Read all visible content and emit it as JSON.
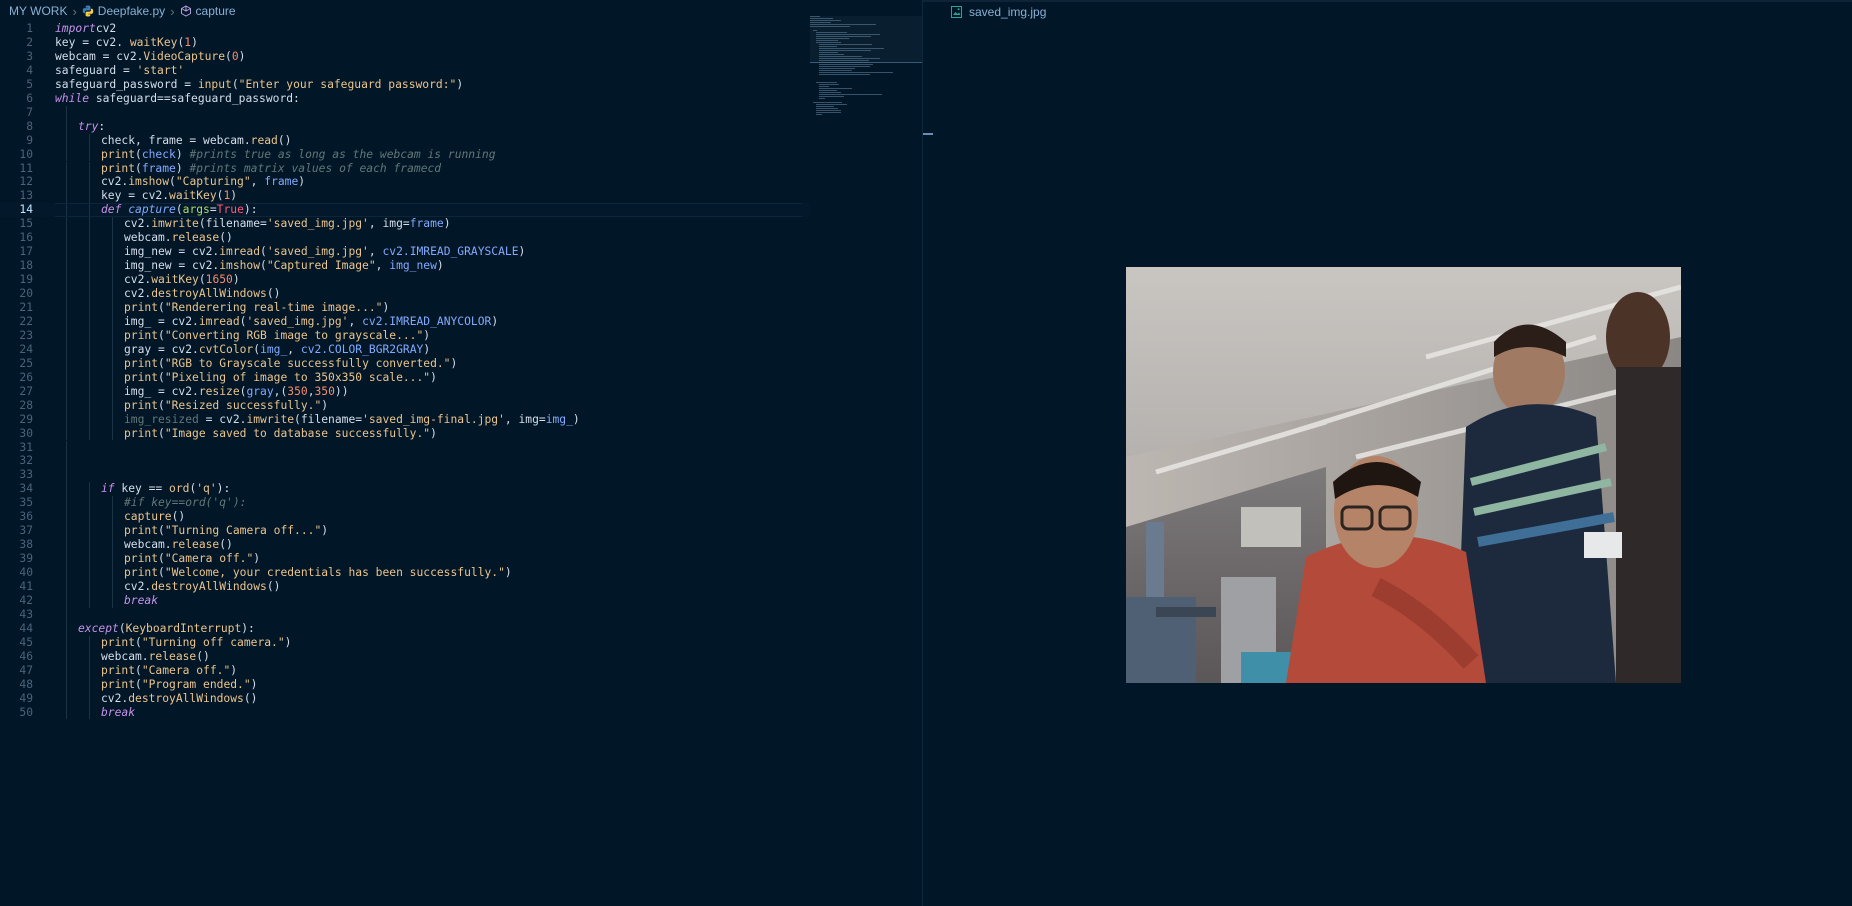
{
  "breadcrumb": {
    "root": "MY WORK",
    "file": "Deepfake.py",
    "symbol": "capture"
  },
  "preview": {
    "tab_label": "saved_img.jpg"
  },
  "editor": {
    "active_line": 14,
    "lines": [
      {
        "n": "1",
        "indent": 0,
        "tokens": [
          [
            "kw",
            "import"
          ],
          [
            "",
            "cv2"
          ]
        ]
      },
      {
        "n": "2",
        "indent": 0,
        "tokens": [
          [
            "",
            "key = cv2. "
          ],
          [
            "fn",
            "waitKey"
          ],
          [
            "",
            "("
          ],
          [
            "num",
            "1"
          ],
          [
            "",
            ")"
          ]
        ]
      },
      {
        "n": "3",
        "indent": 0,
        "tokens": [
          [
            "",
            "webcam = cv2."
          ],
          [
            "fn",
            "VideoCapture"
          ],
          [
            "",
            "("
          ],
          [
            "num",
            "0"
          ],
          [
            "",
            ")"
          ]
        ]
      },
      {
        "n": "4",
        "indent": 0,
        "tokens": [
          [
            "",
            "safeguard = "
          ],
          [
            "str",
            "'start'"
          ]
        ]
      },
      {
        "n": "5",
        "indent": 0,
        "tokens": [
          [
            "",
            "safeguard_password = "
          ],
          [
            "fn",
            "input"
          ],
          [
            "",
            "("
          ],
          [
            "str",
            "\"Enter your safeguard password:\""
          ],
          [
            "",
            ")"
          ]
        ]
      },
      {
        "n": "6",
        "indent": 0,
        "tokens": [
          [
            "kw",
            "while"
          ],
          [
            "",
            " safeguard==safeguard_password:"
          ]
        ]
      },
      {
        "n": "7",
        "indent": 1,
        "tokens": []
      },
      {
        "n": "8",
        "indent": 1,
        "tokens": [
          [
            "kw",
            "try"
          ],
          [
            "",
            ":"
          ]
        ]
      },
      {
        "n": "9",
        "indent": 2,
        "tokens": [
          [
            "",
            "check, frame = webcam."
          ],
          [
            "fn",
            "read"
          ],
          [
            "",
            "()"
          ]
        ]
      },
      {
        "n": "10",
        "indent": 2,
        "tokens": [
          [
            "fn",
            "print"
          ],
          [
            "",
            "("
          ],
          [
            "cst",
            "check"
          ],
          [
            "",
            ") "
          ],
          [
            "cm",
            "#prints true as long as the webcam is running"
          ]
        ]
      },
      {
        "n": "11",
        "indent": 2,
        "tokens": [
          [
            "fn",
            "print"
          ],
          [
            "",
            "("
          ],
          [
            "cst",
            "frame"
          ],
          [
            "",
            ") "
          ],
          [
            "cm",
            "#prints matrix values of each framecd"
          ]
        ]
      },
      {
        "n": "12",
        "indent": 2,
        "tokens": [
          [
            "",
            "cv2."
          ],
          [
            "fn",
            "imshow"
          ],
          [
            "",
            "("
          ],
          [
            "str",
            "\"Capturing\""
          ],
          [
            "",
            ", "
          ],
          [
            "cst",
            "frame"
          ],
          [
            "",
            ")"
          ]
        ]
      },
      {
        "n": "13",
        "indent": 2,
        "tokens": [
          [
            "",
            "key = cv2."
          ],
          [
            "fn",
            "waitKey"
          ],
          [
            "",
            "("
          ],
          [
            "num",
            "1"
          ],
          [
            "",
            ")"
          ]
        ]
      },
      {
        "n": "14",
        "indent": 2,
        "tokens": [
          [
            "kw",
            "def"
          ],
          [
            "",
            " "
          ],
          [
            "ital",
            "capture"
          ],
          [
            "",
            "("
          ],
          [
            "var",
            "args"
          ],
          [
            "",
            "="
          ],
          [
            "bl",
            "True"
          ],
          [
            "",
            "):"
          ]
        ]
      },
      {
        "n": "15",
        "indent": 3,
        "tokens": [
          [
            "",
            "cv2."
          ],
          [
            "fn",
            "imwrite"
          ],
          [
            "",
            "(filename="
          ],
          [
            "str",
            "'saved_img.jpg'"
          ],
          [
            "",
            ", img="
          ],
          [
            "cst",
            "frame"
          ],
          [
            "",
            ")"
          ]
        ]
      },
      {
        "n": "16",
        "indent": 3,
        "tokens": [
          [
            "",
            "webcam."
          ],
          [
            "fn",
            "release"
          ],
          [
            "",
            "()"
          ]
        ]
      },
      {
        "n": "17",
        "indent": 3,
        "tokens": [
          [
            "",
            "img_new = cv2."
          ],
          [
            "fn",
            "imread"
          ],
          [
            "",
            "("
          ],
          [
            "str",
            "'saved_img.jpg'"
          ],
          [
            "",
            ", "
          ],
          [
            "cst",
            "cv2.IMREAD_GRAYSCALE"
          ],
          [
            "",
            ")"
          ]
        ]
      },
      {
        "n": "18",
        "indent": 3,
        "tokens": [
          [
            "",
            "img_new = cv2."
          ],
          [
            "fn",
            "imshow"
          ],
          [
            "",
            "("
          ],
          [
            "str",
            "\"Captured Image\""
          ],
          [
            "",
            ", "
          ],
          [
            "cst",
            "img_new"
          ],
          [
            "",
            ")"
          ]
        ]
      },
      {
        "n": "19",
        "indent": 3,
        "tokens": [
          [
            "",
            "cv2."
          ],
          [
            "fn",
            "waitKey"
          ],
          [
            "",
            "("
          ],
          [
            "num",
            "1650"
          ],
          [
            "",
            ")"
          ]
        ]
      },
      {
        "n": "20",
        "indent": 3,
        "tokens": [
          [
            "",
            "cv2."
          ],
          [
            "fn",
            "destroyAllWindows"
          ],
          [
            "",
            "()"
          ]
        ]
      },
      {
        "n": "21",
        "indent": 3,
        "tokens": [
          [
            "fn",
            "print"
          ],
          [
            "",
            "("
          ],
          [
            "str",
            "\"Renderering real-time image...\""
          ],
          [
            "",
            ")"
          ]
        ]
      },
      {
        "n": "22",
        "indent": 3,
        "tokens": [
          [
            "",
            "img_ = cv2."
          ],
          [
            "fn",
            "imread"
          ],
          [
            "",
            "("
          ],
          [
            "str",
            "'saved_img.jpg'"
          ],
          [
            "",
            ", "
          ],
          [
            "cst",
            "cv2.IMREAD_ANYCOLOR"
          ],
          [
            "",
            ")"
          ]
        ]
      },
      {
        "n": "23",
        "indent": 3,
        "tokens": [
          [
            "fn",
            "print"
          ],
          [
            "",
            "("
          ],
          [
            "str",
            "\"Converting RGB image to grayscale...\""
          ],
          [
            "",
            ")"
          ]
        ]
      },
      {
        "n": "24",
        "indent": 3,
        "tokens": [
          [
            "",
            "gray = cv2."
          ],
          [
            "fn",
            "cvtColor"
          ],
          [
            "",
            "("
          ],
          [
            "cst",
            "img_"
          ],
          [
            "",
            ", "
          ],
          [
            "cst",
            "cv2.COLOR_BGR2GRAY"
          ],
          [
            "",
            ")"
          ]
        ]
      },
      {
        "n": "25",
        "indent": 3,
        "tokens": [
          [
            "fn",
            "print"
          ],
          [
            "",
            "("
          ],
          [
            "str",
            "\"RGB to Grayscale successfully converted.\""
          ],
          [
            "",
            ")"
          ]
        ]
      },
      {
        "n": "26",
        "indent": 3,
        "tokens": [
          [
            "fn",
            "print"
          ],
          [
            "",
            "("
          ],
          [
            "str",
            "\"Pixeling of image to 350x350 scale...\""
          ],
          [
            "",
            ")"
          ]
        ]
      },
      {
        "n": "27",
        "indent": 3,
        "tokens": [
          [
            "",
            "img_ = cv2."
          ],
          [
            "fn",
            "resize"
          ],
          [
            "",
            "("
          ],
          [
            "cst",
            "gray"
          ],
          [
            "",
            ",("
          ],
          [
            "num",
            "350"
          ],
          [
            "",
            ","
          ],
          [
            "num",
            "350"
          ],
          [
            "",
            "))"
          ]
        ]
      },
      {
        "n": "28",
        "indent": 3,
        "tokens": [
          [
            "fn",
            "print"
          ],
          [
            "",
            "("
          ],
          [
            "str",
            "\"Resized successfully.\""
          ],
          [
            "",
            ")"
          ]
        ]
      },
      {
        "n": "29",
        "indent": 3,
        "tokens": [
          [
            "cm2",
            "img_resized"
          ],
          [
            "",
            " = cv2."
          ],
          [
            "fn",
            "imwrite"
          ],
          [
            "",
            "(filename="
          ],
          [
            "str",
            "'saved_img-final.jpg'"
          ],
          [
            "",
            ", img="
          ],
          [
            "cst",
            "img_"
          ],
          [
            "",
            ")"
          ]
        ]
      },
      {
        "n": "30",
        "indent": 3,
        "tokens": [
          [
            "fn",
            "print"
          ],
          [
            "",
            "("
          ],
          [
            "str",
            "\"Image saved to database successfully.\""
          ],
          [
            "",
            ")"
          ]
        ]
      },
      {
        "n": "31",
        "indent": 1,
        "tokens": []
      },
      {
        "n": "32",
        "indent": 1,
        "tokens": []
      },
      {
        "n": "33",
        "indent": 1,
        "tokens": []
      },
      {
        "n": "34",
        "indent": 2,
        "tokens": [
          [
            "kw",
            "if"
          ],
          [
            "",
            " key == "
          ],
          [
            "fn",
            "ord"
          ],
          [
            "",
            "("
          ],
          [
            "str",
            "'q'"
          ],
          [
            "",
            "):"
          ]
        ]
      },
      {
        "n": "35",
        "indent": 3,
        "tokens": [
          [
            "cm",
            "#if key==ord('q'):"
          ]
        ]
      },
      {
        "n": "36",
        "indent": 3,
        "tokens": [
          [
            "fn",
            "capture"
          ],
          [
            "",
            "()"
          ]
        ]
      },
      {
        "n": "37",
        "indent": 3,
        "tokens": [
          [
            "fn",
            "print"
          ],
          [
            "",
            "("
          ],
          [
            "str",
            "\"Turning Camera off...\""
          ],
          [
            "",
            ")"
          ]
        ]
      },
      {
        "n": "38",
        "indent": 3,
        "tokens": [
          [
            "",
            "webcam."
          ],
          [
            "fn",
            "release"
          ],
          [
            "",
            "()"
          ]
        ]
      },
      {
        "n": "39",
        "indent": 3,
        "tokens": [
          [
            "fn",
            "print"
          ],
          [
            "",
            "("
          ],
          [
            "str",
            "\"Camera off.\""
          ],
          [
            "",
            ")"
          ]
        ]
      },
      {
        "n": "40",
        "indent": 3,
        "tokens": [
          [
            "fn",
            "print"
          ],
          [
            "",
            "("
          ],
          [
            "str",
            "\"Welcome, your credentials has been successfully.\""
          ],
          [
            "",
            ")"
          ]
        ]
      },
      {
        "n": "41",
        "indent": 3,
        "tokens": [
          [
            "",
            "cv2."
          ],
          [
            "fn",
            "destroyAllWindows"
          ],
          [
            "",
            "()"
          ]
        ]
      },
      {
        "n": "42",
        "indent": 3,
        "tokens": [
          [
            "kw",
            "break"
          ]
        ]
      },
      {
        "n": "43",
        "indent": 1,
        "tokens": []
      },
      {
        "n": "44",
        "indent": 1,
        "tokens": [
          [
            "kw",
            "except"
          ],
          [
            "",
            "("
          ],
          [
            "fn",
            "KeyboardInterrupt"
          ],
          [
            "",
            "):"
          ]
        ]
      },
      {
        "n": "45",
        "indent": 2,
        "tokens": [
          [
            "fn",
            "print"
          ],
          [
            "",
            "("
          ],
          [
            "str",
            "\"Turning off camera.\""
          ],
          [
            "",
            ")"
          ]
        ]
      },
      {
        "n": "46",
        "indent": 2,
        "tokens": [
          [
            "",
            "webcam."
          ],
          [
            "fn",
            "release"
          ],
          [
            "",
            "()"
          ]
        ]
      },
      {
        "n": "47",
        "indent": 2,
        "tokens": [
          [
            "fn",
            "print"
          ],
          [
            "",
            "("
          ],
          [
            "str",
            "\"Camera off.\""
          ],
          [
            "",
            ")"
          ]
        ]
      },
      {
        "n": "48",
        "indent": 2,
        "tokens": [
          [
            "fn",
            "print"
          ],
          [
            "",
            "("
          ],
          [
            "str",
            "\"Program ended.\""
          ],
          [
            "",
            ")"
          ]
        ]
      },
      {
        "n": "49",
        "indent": 2,
        "tokens": [
          [
            "",
            "cv2."
          ],
          [
            "fn",
            "destroyAllWindows"
          ],
          [
            "",
            "()"
          ]
        ]
      },
      {
        "n": "50",
        "indent": 2,
        "tokens": [
          [
            "kw",
            "break"
          ]
        ]
      }
    ]
  }
}
